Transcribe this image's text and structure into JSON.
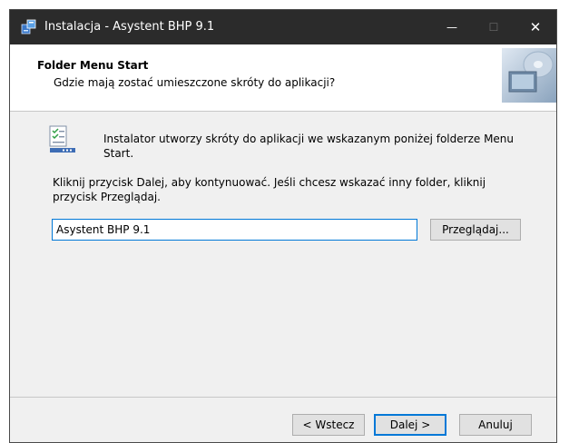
{
  "window": {
    "title": "Instalacja - Asystent BHP 9.1"
  },
  "titlebar_buttons": {
    "minimize_glyph": "—",
    "maximize_glyph": "☐",
    "close_glyph": "✕"
  },
  "header": {
    "title": "Folder Menu Start",
    "subtitle": "Gdzie mają zostać umieszczone skróty do aplikacji?"
  },
  "content": {
    "intro": "Instalator utworzy skróty do aplikacji we wskazanym poniżej folderze Menu Start.",
    "instructions": "Kliknij przycisk Dalej, aby kontynuować. Jeśli chcesz wskazać inny folder, kliknij przycisk Przeglądaj.",
    "folder_value": "Asystent BHP 9.1",
    "browse_label": "Przeglądaj..."
  },
  "footer": {
    "back_label": "< Wstecz",
    "next_label": "Dalej >",
    "cancel_label": "Anuluj"
  },
  "colors": {
    "titlebar": "#2b2b2b",
    "accent": "#0078d7",
    "dialog_bg": "#f0f0f0"
  },
  "icons": [
    "app-installer-icon",
    "minimize-icon",
    "maximize-icon",
    "close-icon",
    "wizard-header-image",
    "start-menu-folder-icon"
  ]
}
